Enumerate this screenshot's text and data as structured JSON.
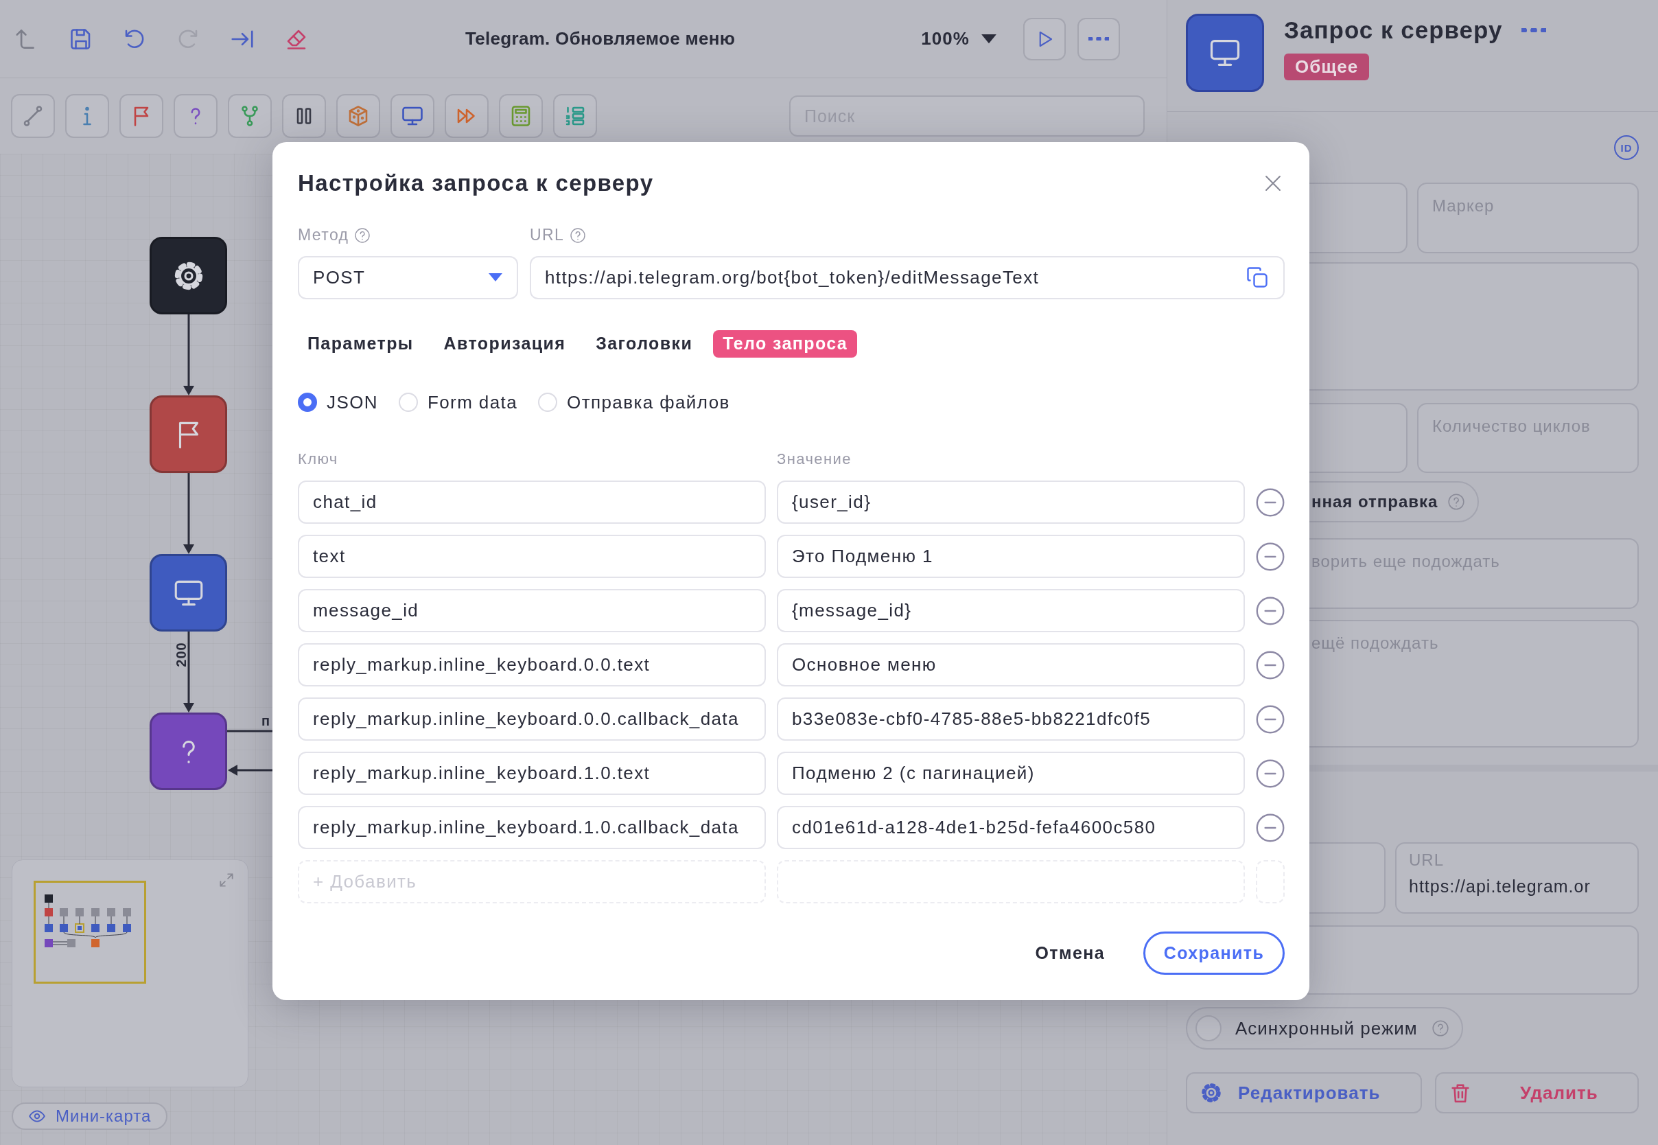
{
  "topbar": {
    "title": "Telegram. Обновляемое меню",
    "zoom": "100%"
  },
  "palette": {
    "search_placeholder": "Поиск"
  },
  "canvas": {
    "nodes": [
      {
        "kind": "start",
        "color": "#22252f"
      },
      {
        "kind": "flag",
        "color": "#b04848"
      },
      {
        "kind": "request",
        "color": "#3f5bbf"
      },
      {
        "kind": "condition",
        "color": "#7548bb"
      }
    ],
    "edge_labels": [
      "200",
      "п"
    ]
  },
  "minimap": {
    "toggle": "Мини-карта"
  },
  "side_panel": {
    "title": "Запрос к серверу",
    "tag": "Общее",
    "id_badge": "ID",
    "marker_placeholder": "Маркер",
    "cycles_placeholder": "Количество циклов",
    "toggle_label": "нная отправка",
    "field_placeholder": "ворить еще подождать",
    "textarea_placeholder": "ещё подождать",
    "url_label": "URL",
    "url_value": "https://api.telegram.or",
    "async": {
      "label": "Асинхронный режим",
      "checked": false
    },
    "edit_button": "Редактировать",
    "delete_button": "Удалить"
  },
  "dialog": {
    "title": "Настройка запроса к серверу",
    "method_label": "Метод",
    "method": "POST",
    "url_label": "URL",
    "url": "https://api.telegram.org/bot{bot_token}/editMessageText",
    "tabs": [
      {
        "label": "Параметры",
        "selected": false
      },
      {
        "label": "Авторизация",
        "selected": false
      },
      {
        "label": "Заголовки",
        "selected": false
      },
      {
        "label": "Тело запроса",
        "selected": true
      }
    ],
    "body_types": [
      {
        "label": "JSON",
        "selected": true
      },
      {
        "label": "Form data",
        "selected": false
      },
      {
        "label": "Отправка файлов",
        "selected": false
      }
    ],
    "key_header": "Ключ",
    "value_header": "Значение",
    "rows": [
      {
        "key": "chat_id",
        "value": "{user_id}"
      },
      {
        "key": "text",
        "value": "Это Подменю 1"
      },
      {
        "key": "message_id",
        "value": "{message_id}"
      },
      {
        "key": "reply_markup.inline_keyboard.0.0.text",
        "value": "Основное меню"
      },
      {
        "key": "reply_markup.inline_keyboard.0.0.callback_data",
        "value": "b33e083e-cbf0-4785-88e5-bb8221dfc0f5"
      },
      {
        "key": "reply_markup.inline_keyboard.1.0.text",
        "value": "Подменю 2 (с пагинацией)"
      },
      {
        "key": "reply_markup.inline_keyboard.1.0.callback_data",
        "value": "cd01e61d-a128-4de1-b25d-fefa4600c580"
      }
    ],
    "add_placeholder": "+ Добавить",
    "cancel": "Отмена",
    "save": "Сохранить"
  }
}
